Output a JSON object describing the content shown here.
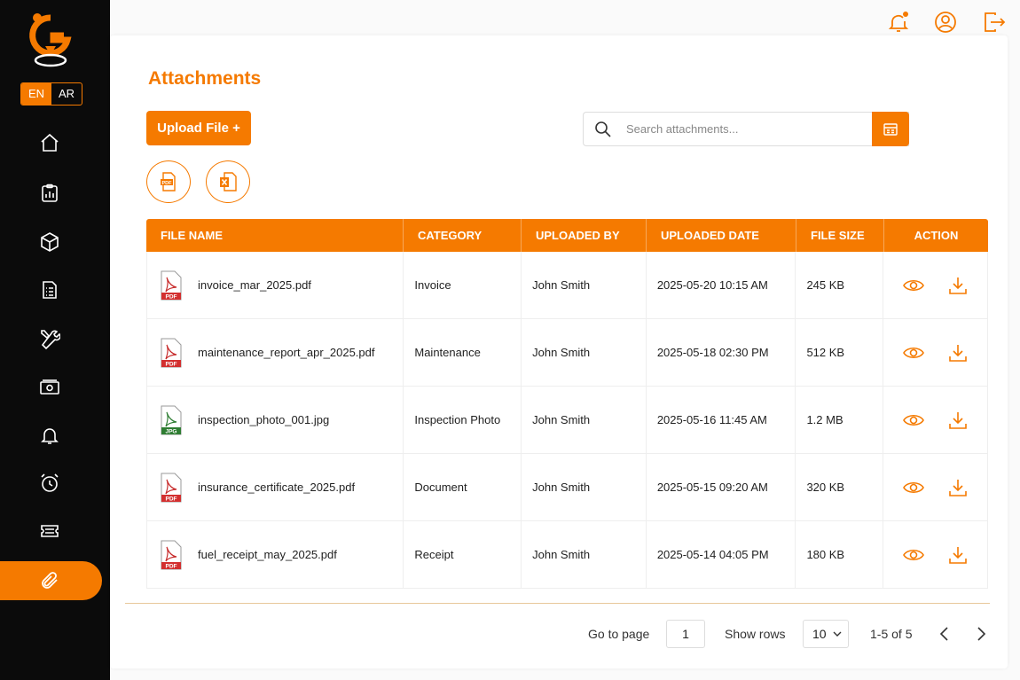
{
  "colors": {
    "accent": "#f57a00",
    "sidebar": "#0b0b0b"
  },
  "language": {
    "en": "EN",
    "ar": "AR",
    "selected": "EN"
  },
  "sidebar": {
    "items": [
      {
        "icon": "home-icon"
      },
      {
        "icon": "reports-icon"
      },
      {
        "icon": "box-icon"
      },
      {
        "icon": "document-list-icon"
      },
      {
        "icon": "tools-icon"
      },
      {
        "icon": "money-icon"
      },
      {
        "icon": "bell-icon"
      },
      {
        "icon": "alarm-clock-icon"
      },
      {
        "icon": "ticket-icon"
      },
      {
        "icon": "paperclip-icon",
        "active": true
      }
    ]
  },
  "topbar": {
    "icons": [
      "notification-bell-icon",
      "user-profile-icon",
      "logout-icon"
    ]
  },
  "page": {
    "title": "Attachments",
    "upload_label": "Upload File +",
    "export_icons": [
      "pdf-export-icon",
      "excel-export-icon"
    ]
  },
  "search": {
    "placeholder": "Search attachments...",
    "value": ""
  },
  "table": {
    "headers": [
      "FILE NAME",
      "CATEGORY",
      "UPLOADED BY",
      "UPLOADED DATE",
      "FILE SIZE",
      "ACTION"
    ],
    "rows": [
      {
        "type": "PDF",
        "name": "invoice_mar_2025.pdf",
        "category": "Invoice",
        "uploaded_by": "John Smith",
        "date": "2025-05-20 10:15 AM",
        "size": "245 KB"
      },
      {
        "type": "PDF",
        "name": "maintenance_report_apr_2025.pdf",
        "category": "Maintenance",
        "uploaded_by": "John Smith",
        "date": "2025-05-18 02:30 PM",
        "size": "512 KB"
      },
      {
        "type": "JPG",
        "name": "inspection_photo_001.jpg",
        "category": "Inspection Photo",
        "uploaded_by": "John Smith",
        "date": "2025-05-16 11:45 AM",
        "size": "1.2 MB"
      },
      {
        "type": "PDF",
        "name": "insurance_certificate_2025.pdf",
        "category": "Document",
        "uploaded_by": "John Smith",
        "date": "2025-05-15 09:20 AM",
        "size": "320 KB"
      },
      {
        "type": "PDF",
        "name": "fuel_receipt_may_2025.pdf",
        "category": "Receipt",
        "uploaded_by": "John Smith",
        "date": "2025-05-14 04:05 PM",
        "size": "180 KB"
      }
    ]
  },
  "pagination": {
    "go_to_label": "Go to page",
    "page": "1",
    "show_rows_label": "Show rows",
    "rows": "10",
    "range": "1-5 of 5"
  }
}
